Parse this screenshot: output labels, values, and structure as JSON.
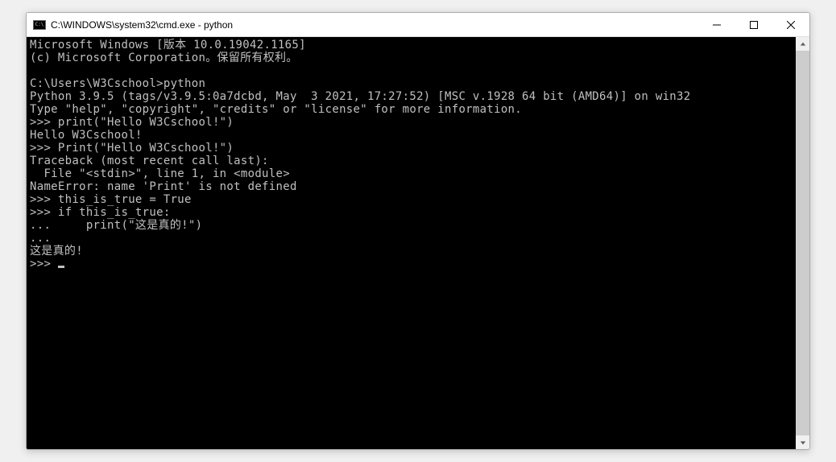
{
  "window": {
    "title": "C:\\WINDOWS\\system32\\cmd.exe - python"
  },
  "terminal": {
    "lines": [
      "Microsoft Windows [版本 10.0.19042.1165]",
      "(c) Microsoft Corporation。保留所有权利。",
      "",
      "C:\\Users\\W3Cschool>python",
      "Python 3.9.5 (tags/v3.9.5:0a7dcbd, May  3 2021, 17:27:52) [MSC v.1928 64 bit (AMD64)] on win32",
      "Type \"help\", \"copyright\", \"credits\" or \"license\" for more information.",
      ">>> print(\"Hello W3Cschool!\")",
      "Hello W3Cschool!",
      ">>> Print(\"Hello W3Cschool!\")",
      "Traceback (most recent call last):",
      "  File \"<stdin>\", line 1, in <module>",
      "NameError: name 'Print' is not defined",
      ">>> this_is_true = True",
      ">>> if this_is_true:",
      "...     print(\"这是真的!\")",
      "...",
      "这是真的!",
      ">>> "
    ]
  }
}
